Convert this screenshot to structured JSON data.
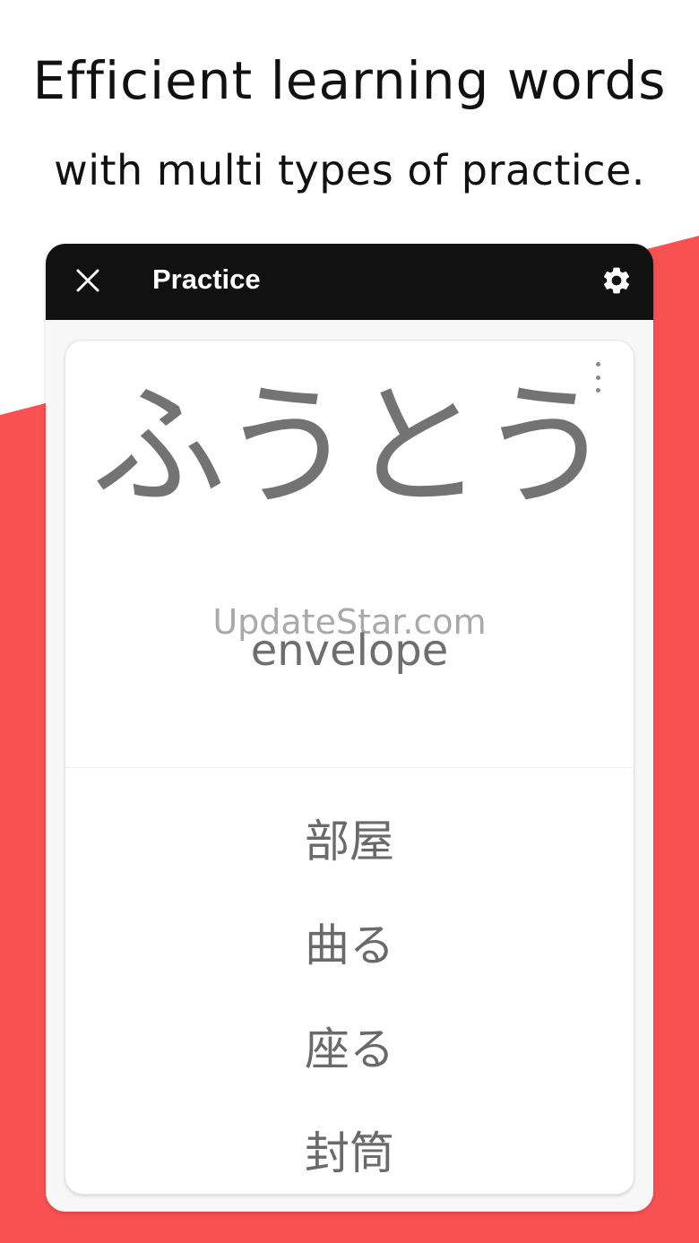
{
  "headline": {
    "line1": "Efficient learning words",
    "line2": "with multi types of practice."
  },
  "colors": {
    "accent": "#f95152",
    "appbar": "#111111",
    "text_gray": "#737373"
  },
  "appbar": {
    "title": "Practice",
    "close_icon": "close-icon",
    "settings_icon": "gear-icon"
  },
  "card": {
    "more_icon": "more-vertical-icon",
    "word": "ふうとう",
    "watermark": "UpdateStar.com",
    "meaning": "envelope",
    "options": [
      {
        "label": "部屋"
      },
      {
        "label": "曲る"
      },
      {
        "label": "座る"
      },
      {
        "label": "封筒"
      }
    ]
  }
}
